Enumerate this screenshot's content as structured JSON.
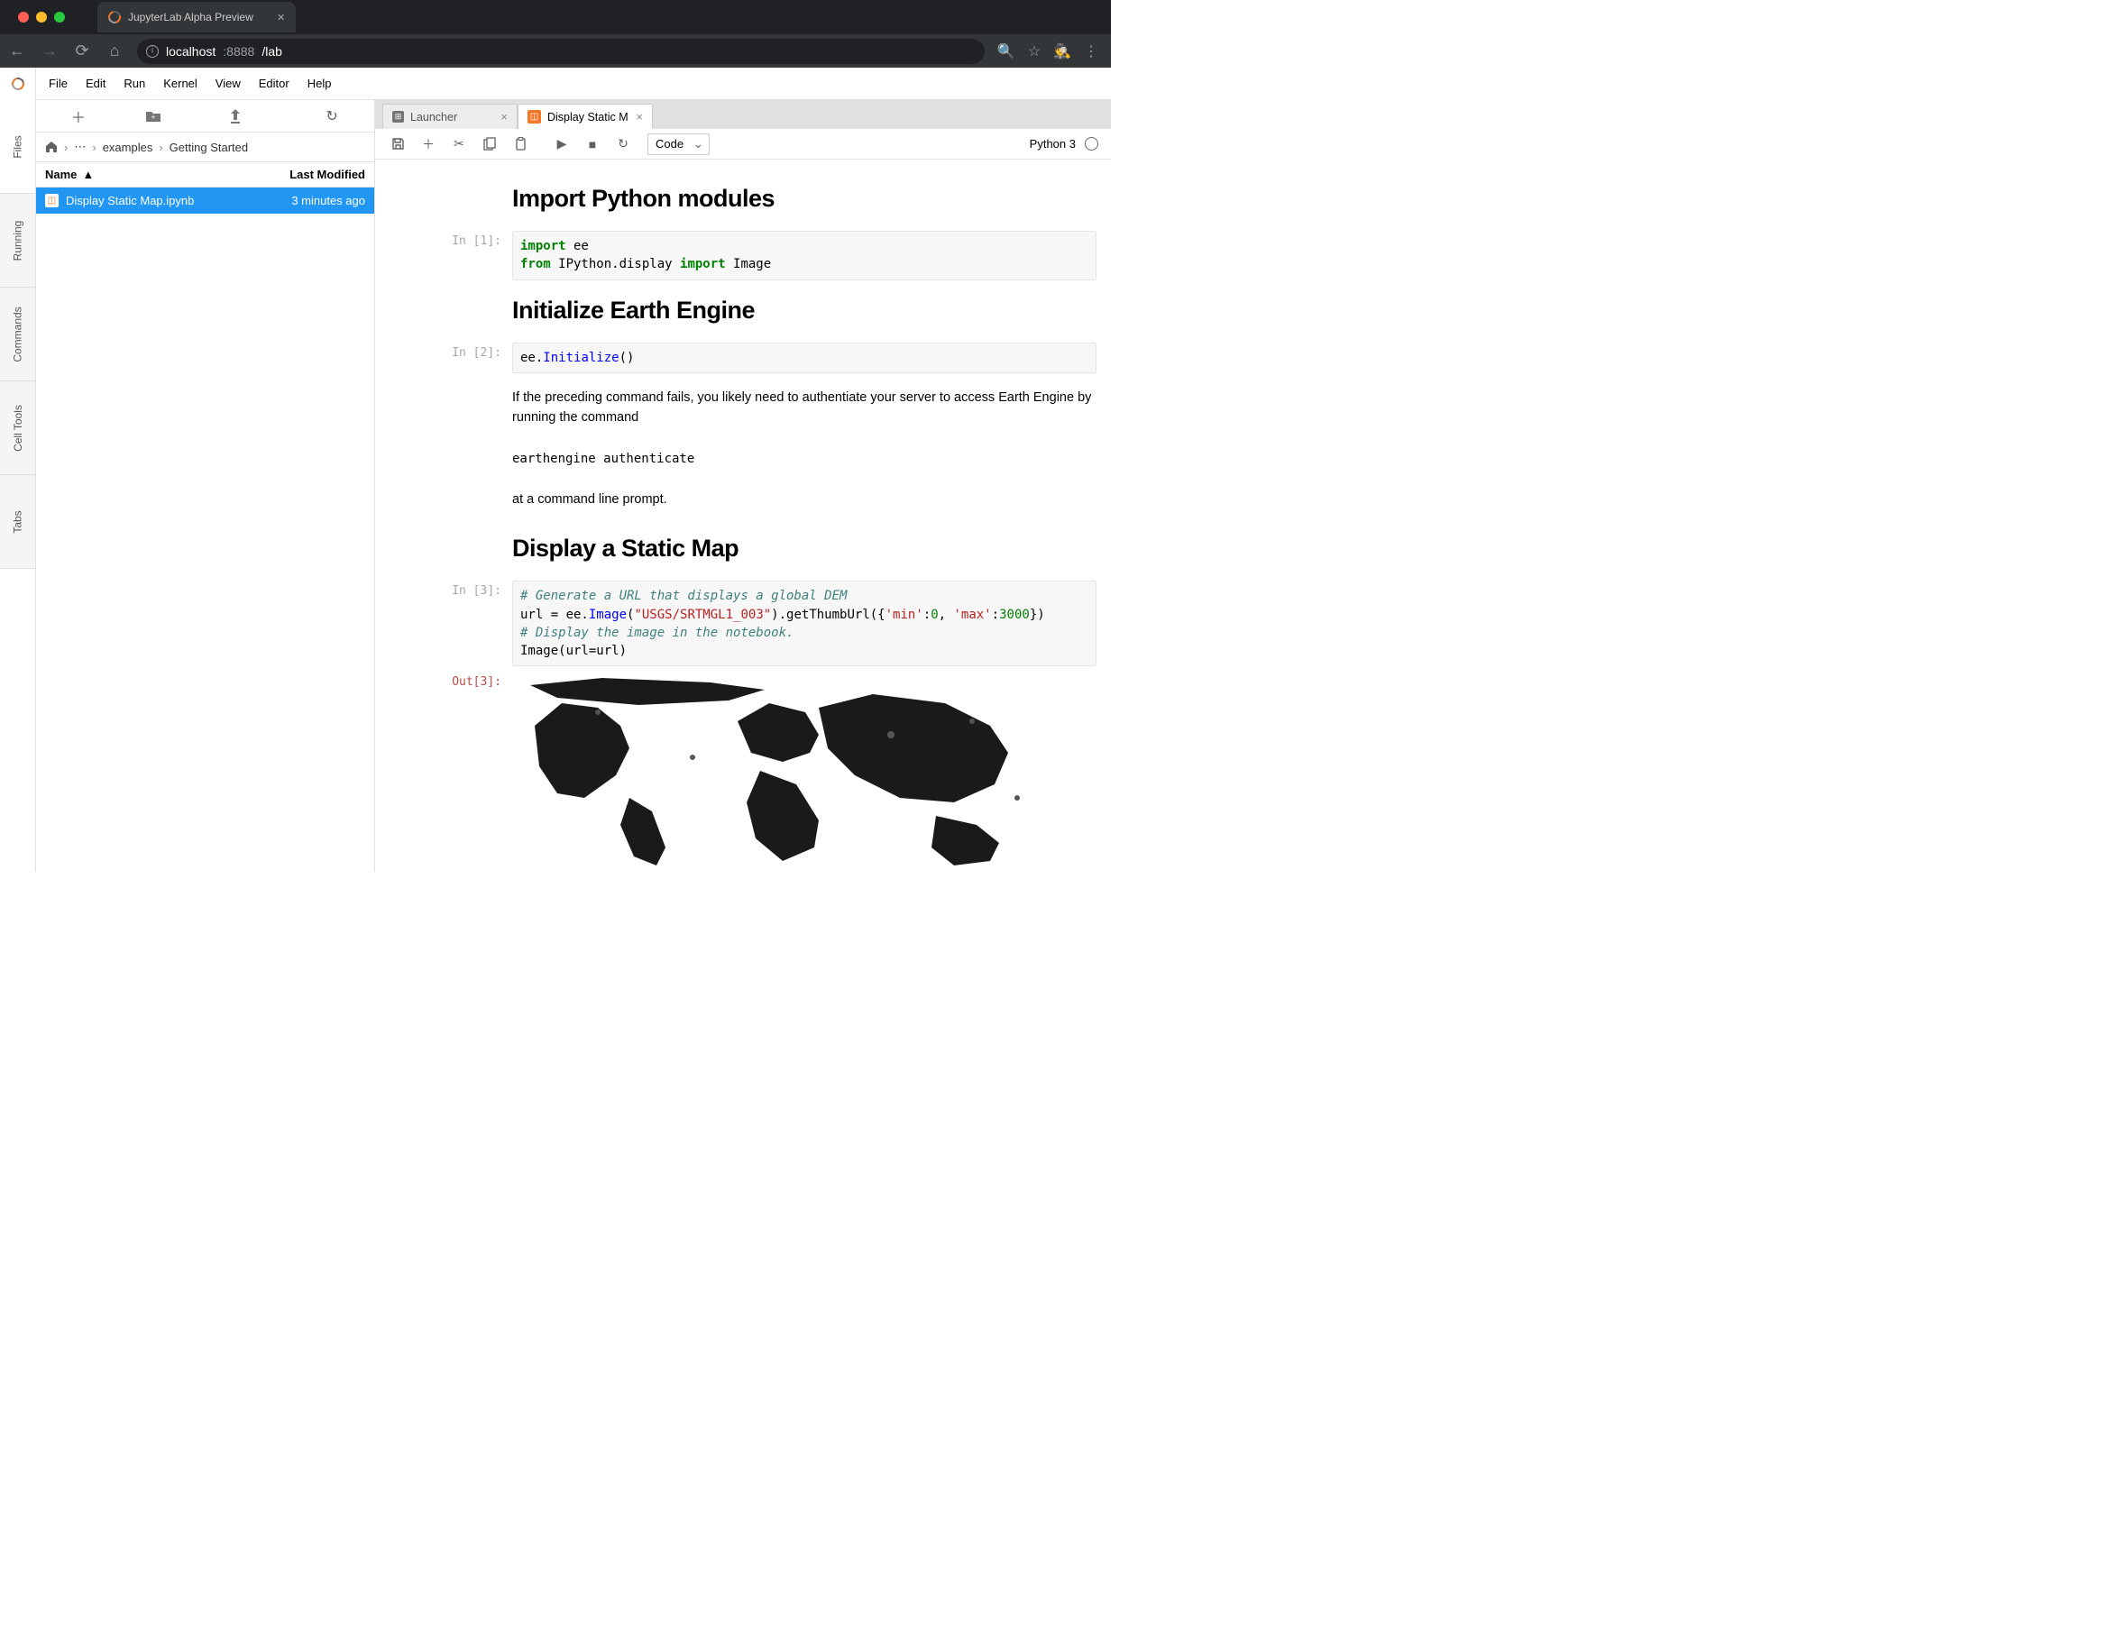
{
  "browser": {
    "tab_title": "JupyterLab Alpha Preview",
    "url_host": "localhost",
    "url_port": ":8888",
    "url_path": "/lab"
  },
  "menu": {
    "items": [
      "File",
      "Edit",
      "Run",
      "Kernel",
      "View",
      "Editor",
      "Help"
    ]
  },
  "left_rail": {
    "tabs": [
      "Files",
      "Running",
      "Commands",
      "Cell Tools",
      "Tabs"
    ],
    "active": 0
  },
  "file_browser": {
    "breadcrumb": {
      "root_icon": "🏠",
      "ellipsis": "⋯",
      "parts": [
        "examples",
        "Getting Started"
      ]
    },
    "columns": {
      "name": "Name",
      "modified": "Last Modified"
    },
    "rows": [
      {
        "name": "Display Static Map.ipynb",
        "modified": "3 minutes ago",
        "selected": true
      }
    ]
  },
  "doc_tabs": [
    {
      "label": "Launcher",
      "active": false,
      "icon": "launcher"
    },
    {
      "label": "Display Static M",
      "active": true,
      "icon": "notebook"
    }
  ],
  "nb_toolbar": {
    "cell_type": "Code",
    "kernel": "Python 3"
  },
  "notebook": {
    "cells": [
      {
        "type": "md",
        "h2": "Import Python modules"
      },
      {
        "type": "code",
        "prompt": "In [1]:",
        "code_html": "<span class='kw-green'>import</span> ee\n<span class='kw-green'>from</span> IPython.display <span class='kw-green'>import</span> Image"
      },
      {
        "type": "md",
        "h2": "Initialize Earth Engine"
      },
      {
        "type": "code",
        "prompt": "In [2]:",
        "code_html": "ee.<span class='kw-blue'>Initialize</span>()"
      },
      {
        "type": "md",
        "p": "If the preceding command fails, you likely need to authentiate your server to access Earth Engine by running the command"
      },
      {
        "type": "md",
        "code": "earthengine authenticate"
      },
      {
        "type": "md",
        "p": "at a command line prompt."
      },
      {
        "type": "md",
        "h2": "Display a Static Map"
      },
      {
        "type": "code",
        "prompt": "In [3]:",
        "code_html": "<span class='comment'># Generate a URL that displays a global DEM</span>\nurl = ee.<span class='kw-blue'>Image</span>(<span class='str-red'>\"USGS/SRTMGL1_003\"</span>).getThumbUrl({<span class='str-red'>'min'</span>:<span class='num'>0</span>, <span class='str-red'>'max'</span>:<span class='num'>3000</span>})\n<span class='comment'># Display the image in the notebook.</span>\nImage(url=url)"
      },
      {
        "type": "out",
        "prompt": "Out[3]:"
      }
    ]
  }
}
